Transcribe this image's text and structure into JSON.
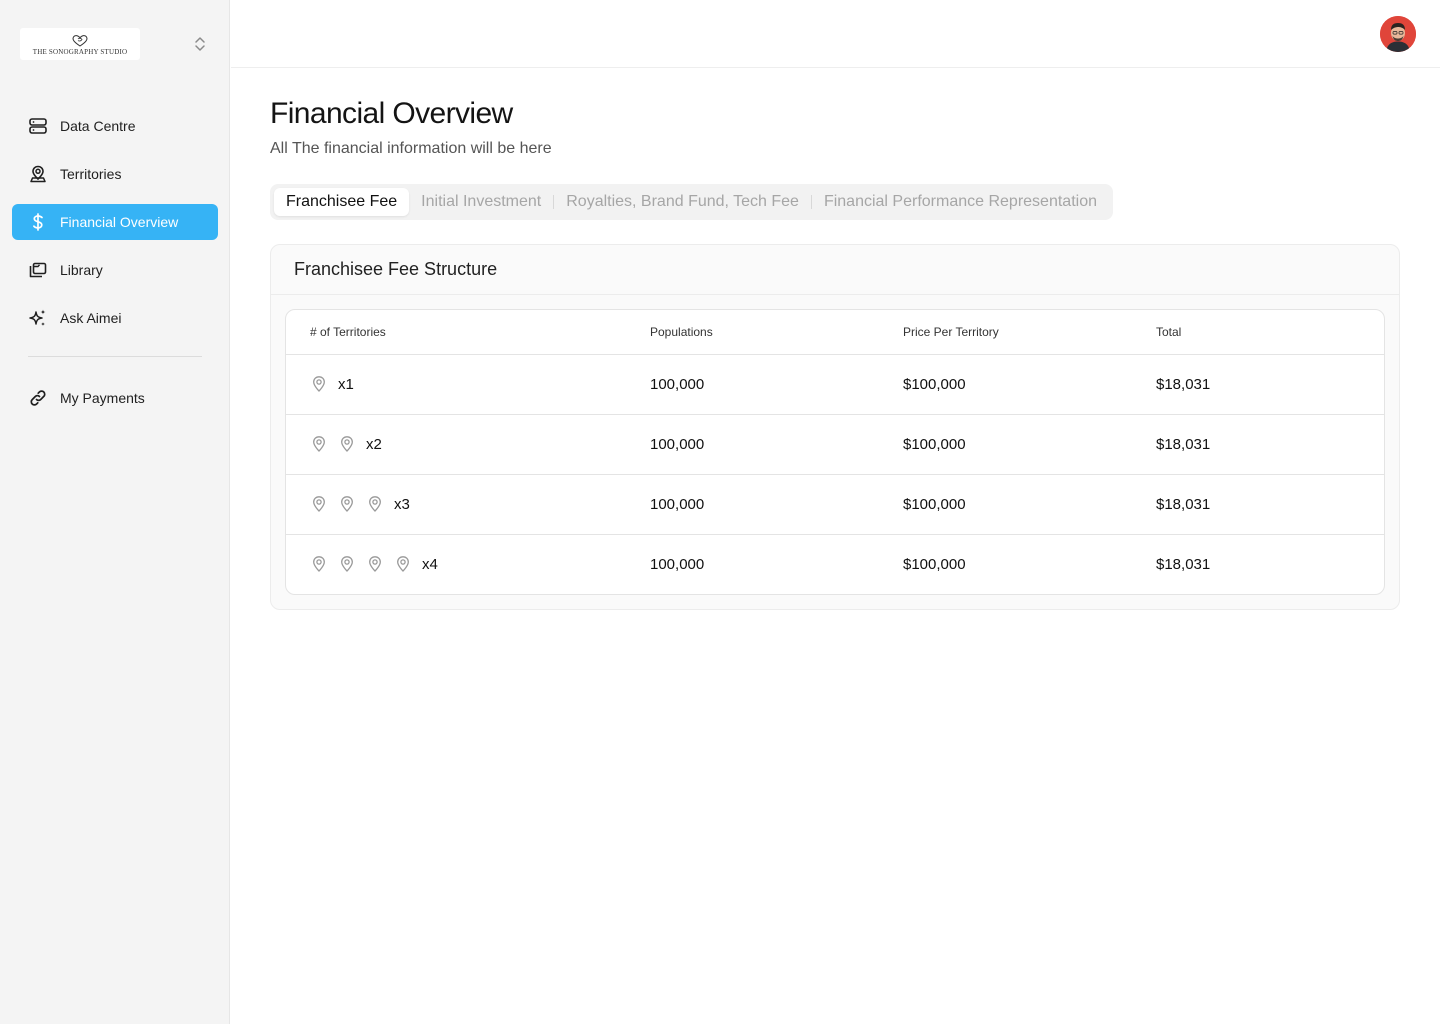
{
  "brand": {
    "name": "THE SONOGRAPHY STUDIO"
  },
  "sidebar": {
    "items": [
      {
        "label": "Data Centre",
        "icon": "server-icon",
        "active": false
      },
      {
        "label": "Territories",
        "icon": "user-location-icon",
        "active": false
      },
      {
        "label": "Financial Overview",
        "icon": "dollar-icon",
        "active": true
      },
      {
        "label": "Library",
        "icon": "library-icon",
        "active": false
      },
      {
        "label": "Ask Aimei",
        "icon": "sparkles-icon",
        "active": false
      }
    ],
    "secondary": [
      {
        "label": "My Payments",
        "icon": "link-icon",
        "active": false
      }
    ]
  },
  "page": {
    "title": "Financial Overview",
    "subtitle": "All The financial information will be here"
  },
  "tabs": [
    {
      "label": "Franchisee Fee",
      "active": true
    },
    {
      "label": "Initial Investment",
      "active": false
    },
    {
      "label": "Royalties, Brand Fund, Tech Fee",
      "active": false
    },
    {
      "label": "Financial Performance Representation",
      "active": false
    }
  ],
  "card": {
    "title": "Franchisee Fee Structure"
  },
  "table": {
    "headers": [
      "# of Territories",
      "Populations",
      "Price Per Territory",
      "Total"
    ],
    "rows": [
      {
        "pins": 1,
        "territories": "x1",
        "population": "100,000",
        "price": "$100,000",
        "total": "$18,031"
      },
      {
        "pins": 2,
        "territories": "x2",
        "population": "100,000",
        "price": "$100,000",
        "total": "$18,031"
      },
      {
        "pins": 3,
        "territories": "x3",
        "population": "100,000",
        "price": "$100,000",
        "total": "$18,031"
      },
      {
        "pins": 4,
        "territories": "x4",
        "population": "100,000",
        "price": "$100,000",
        "total": "$18,031"
      }
    ]
  },
  "colors": {
    "accent": "#36b3f5",
    "sidebar_bg": "#f4f4f4",
    "avatar_bg": "#e0453a"
  }
}
